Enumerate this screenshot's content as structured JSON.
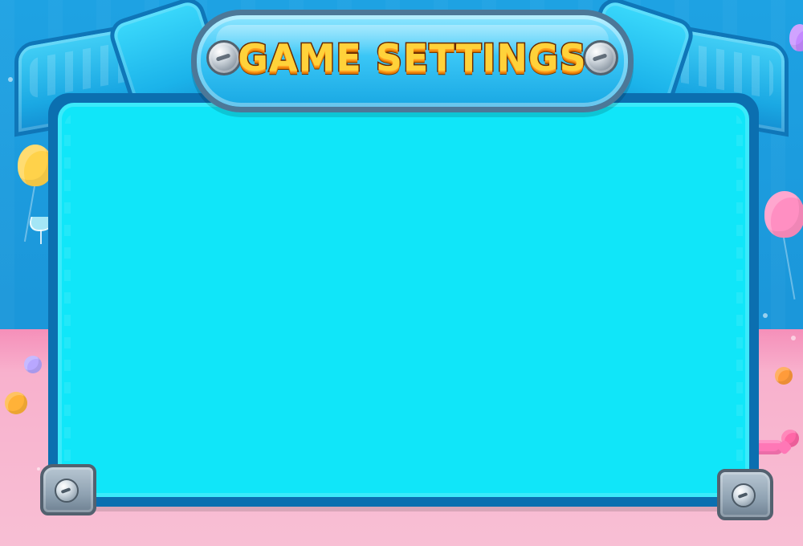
{
  "game": {
    "title": "GAME SETTINGS"
  },
  "theme": {
    "colors": {
      "background_blue": "#1ea2e3",
      "floor_pink": "#f8bfd4",
      "frame_dark_blue": "#0b6fb0",
      "panel_cyan": "#10e6f9",
      "plaque_border": "#4c7898",
      "title_fill": "#ffd23a",
      "title_stroke": "#6b2a00"
    },
    "icons": {
      "screw_left": "screw-icon",
      "screw_right": "screw-icon",
      "bolt_left": "bolt-icon",
      "bolt_right": "bolt-icon",
      "balloon_yellow": "balloon-icon",
      "balloon_pink": "balloon-icon",
      "balloon_purple": "balloon-icon",
      "cocktail_glass": "cocktail-glass-icon",
      "candy": "candy-icon"
    }
  }
}
